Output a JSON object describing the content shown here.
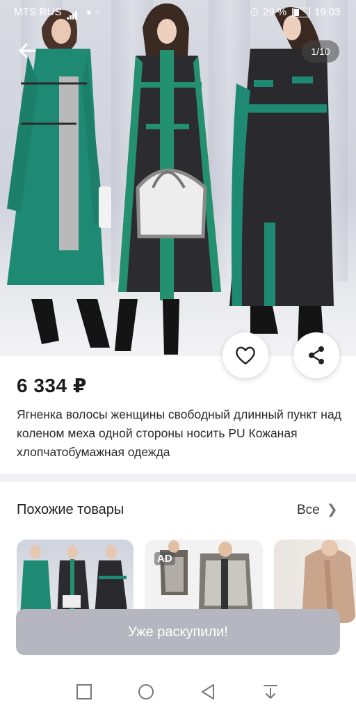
{
  "status_bar": {
    "carrier": "MTS RUS",
    "battery_percent": "29 %",
    "time": "19:03",
    "icons": [
      "signal-icon",
      "message-icon",
      "whatsapp-icon",
      "alarm-icon",
      "battery-icon"
    ]
  },
  "gallery": {
    "counter": "1/10",
    "icons": [
      "back-arrow-icon",
      "heart-icon",
      "share-icon"
    ]
  },
  "product": {
    "price": "6 334 ₽",
    "title": "Ягненка волосы женщины свободный длинный пункт над коленом меха одной стороны носить PU Кожаная хлопчатобумажная одежда"
  },
  "similar": {
    "heading": "Похожие товары",
    "all_label": "Все",
    "items": [
      {
        "badge": ""
      },
      {
        "badge": "AD"
      },
      {
        "badge": ""
      }
    ]
  },
  "action": {
    "button_label": "Уже раскупили!"
  },
  "nav_bar": {
    "icons": [
      "square-icon",
      "home-circle-icon",
      "back-triangle-icon",
      "download-icon"
    ]
  },
  "colors": {
    "coat_green": "#1f8a73",
    "coat_leather": "#2c2c30",
    "button_disabled": "#b6b6c0"
  }
}
